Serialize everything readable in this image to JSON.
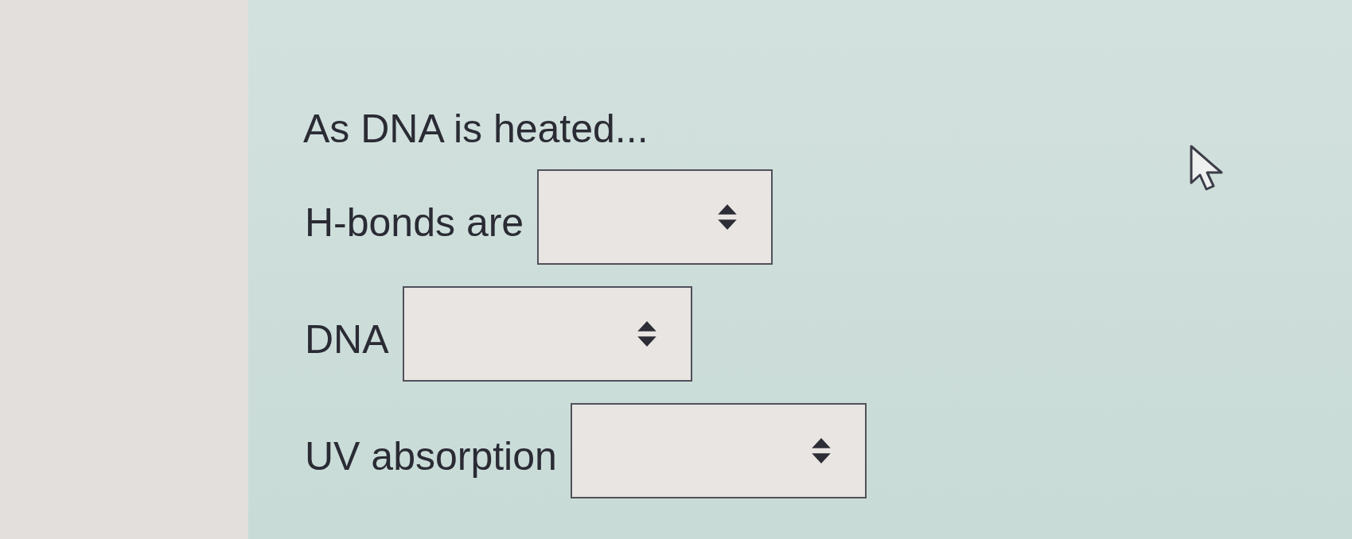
{
  "question": {
    "title": "As DNA is heated..."
  },
  "rows": [
    {
      "label": "H-bonds are"
    },
    {
      "label": "DNA"
    },
    {
      "label": "UV absorption"
    }
  ]
}
